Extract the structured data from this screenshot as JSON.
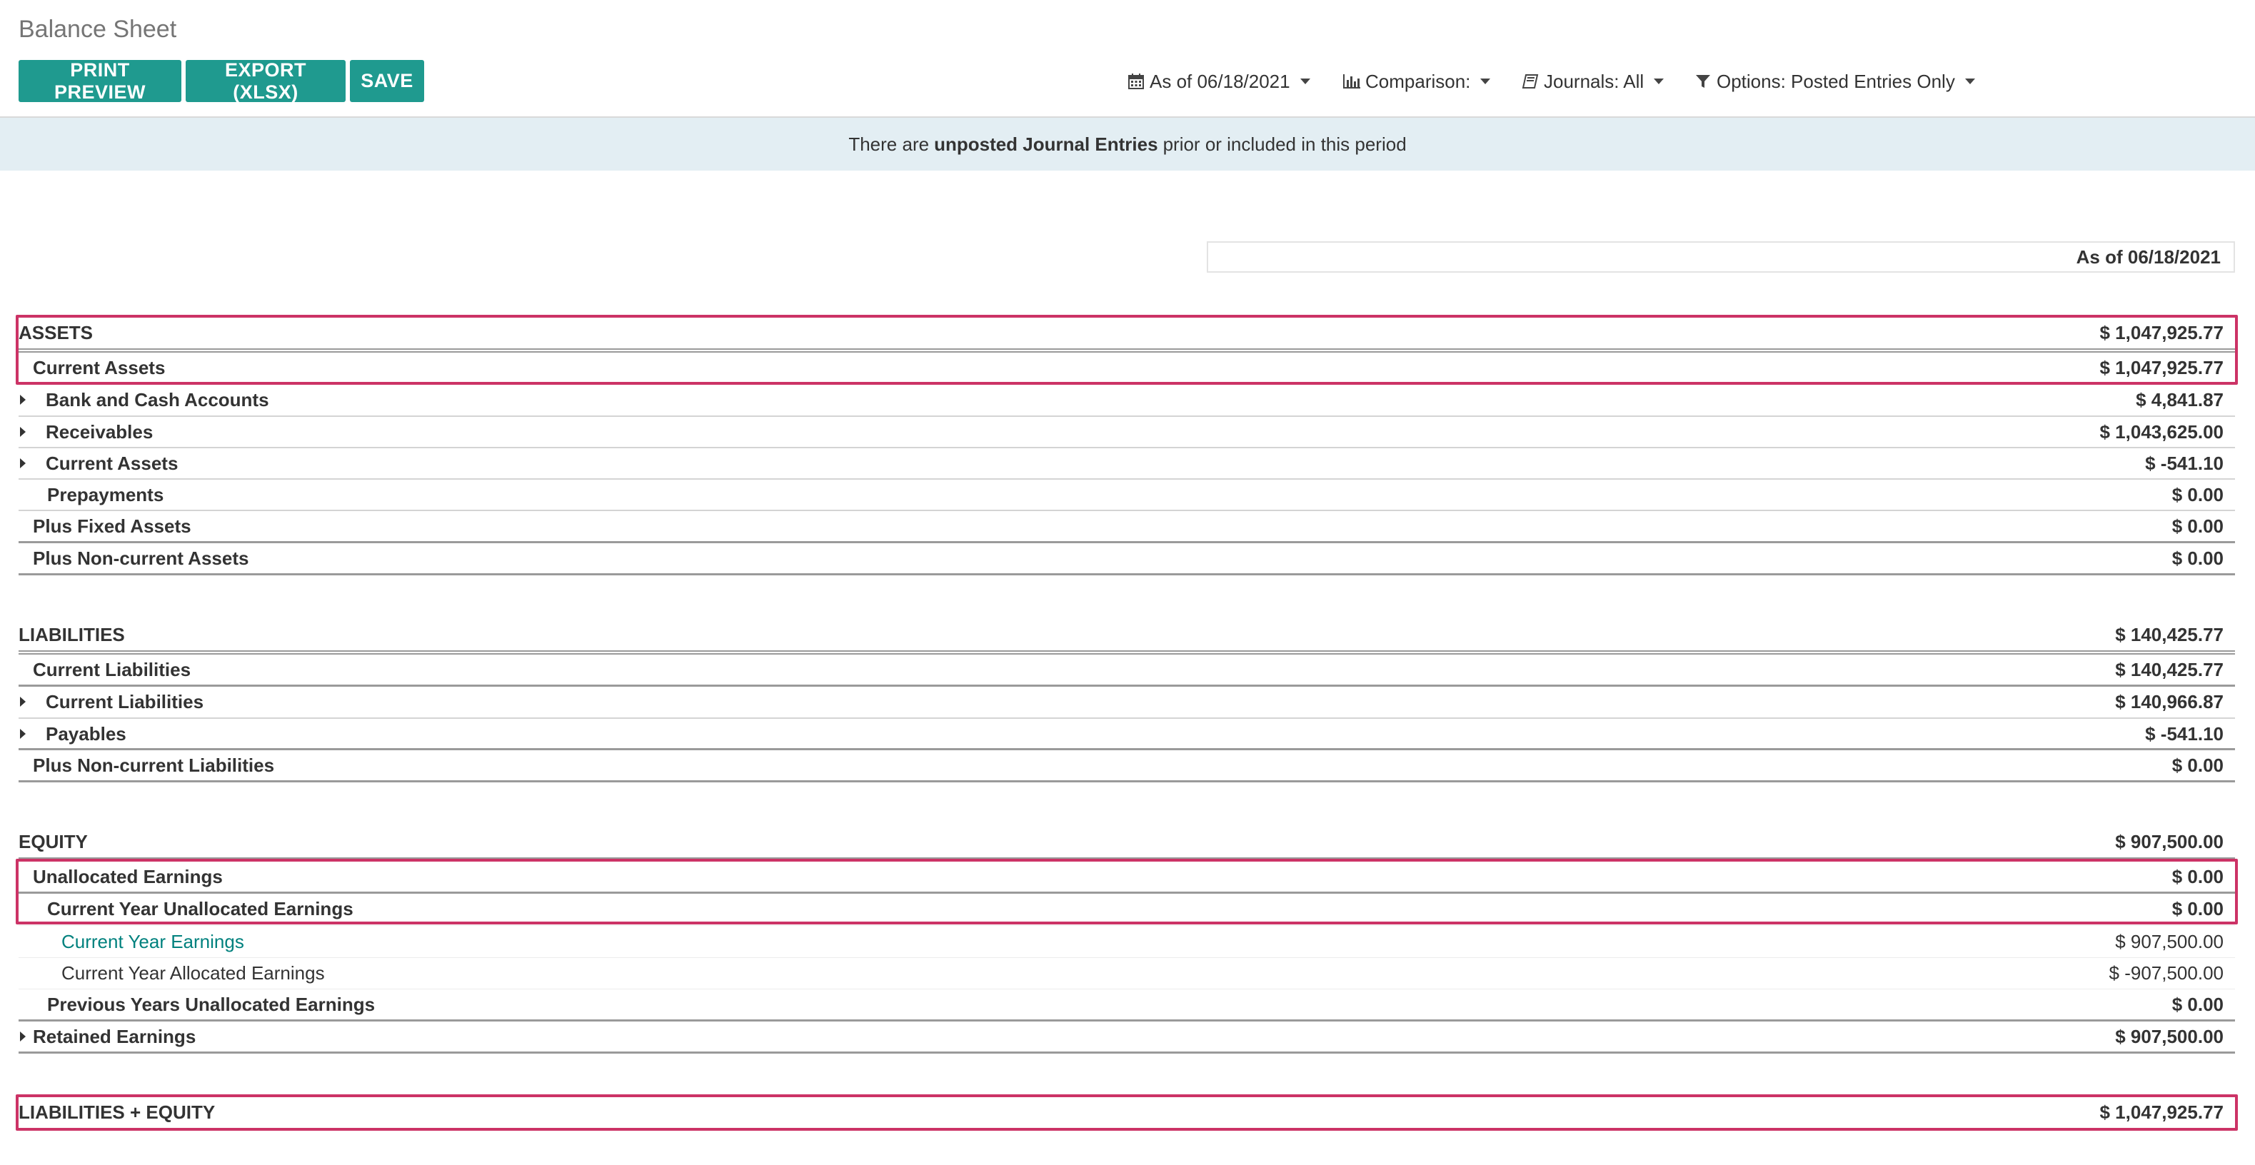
{
  "page": {
    "title": "Balance Sheet"
  },
  "toolbar": {
    "print_preview": "PRINT PREVIEW",
    "export_xlsx": "EXPORT (XLSX)",
    "save": "SAVE",
    "filters": {
      "date": "As of 06/18/2021",
      "comparison": "Comparison:",
      "journals": "Journals: All",
      "options": "Options: Posted Entries Only"
    }
  },
  "banner": {
    "before": "There are",
    "bold": "unposted Journal Entries",
    "after": "prior or included in this period"
  },
  "report": {
    "column_header": "As of 06/18/2021",
    "rows": [
      {
        "label": "ASSETS",
        "amount": "$ 1,047,925.77"
      },
      {
        "label": "Current Assets",
        "amount": "$ 1,047,925.77"
      },
      {
        "label": "Bank and Cash Accounts",
        "amount": "$ 4,841.87"
      },
      {
        "label": "Receivables",
        "amount": "$ 1,043,625.00"
      },
      {
        "label": "Current Assets",
        "amount": "$ -541.10"
      },
      {
        "label": "Prepayments",
        "amount": "$ 0.00"
      },
      {
        "label": "Plus Fixed Assets",
        "amount": "$ 0.00"
      },
      {
        "label": "Plus Non-current Assets",
        "amount": "$ 0.00"
      },
      {
        "label": "LIABILITIES",
        "amount": "$ 140,425.77"
      },
      {
        "label": "Current Liabilities",
        "amount": "$ 140,425.77"
      },
      {
        "label": "Current Liabilities",
        "amount": "$ 140,966.87"
      },
      {
        "label": "Payables",
        "amount": "$ -541.10"
      },
      {
        "label": "Plus Non-current Liabilities",
        "amount": "$ 0.00"
      },
      {
        "label": "EQUITY",
        "amount": "$ 907,500.00"
      },
      {
        "label": "Unallocated Earnings",
        "amount": "$ 0.00"
      },
      {
        "label": "Current Year Unallocated Earnings",
        "amount": "$ 0.00"
      },
      {
        "label": "Current Year Earnings",
        "amount": "$ 907,500.00"
      },
      {
        "label": "Current Year Allocated Earnings",
        "amount": "$ -907,500.00"
      },
      {
        "label": "Previous Years Unallocated Earnings",
        "amount": "$ 0.00"
      },
      {
        "label": "Retained Earnings",
        "amount": "$ 907,500.00"
      },
      {
        "label": "LIABILITIES + EQUITY",
        "amount": "$ 1,047,925.77"
      }
    ]
  },
  "colors": {
    "primary_button": "#1f9a8f",
    "banner_bg": "#e3eef3",
    "highlight_border": "#cc3366",
    "link": "#00817e"
  }
}
